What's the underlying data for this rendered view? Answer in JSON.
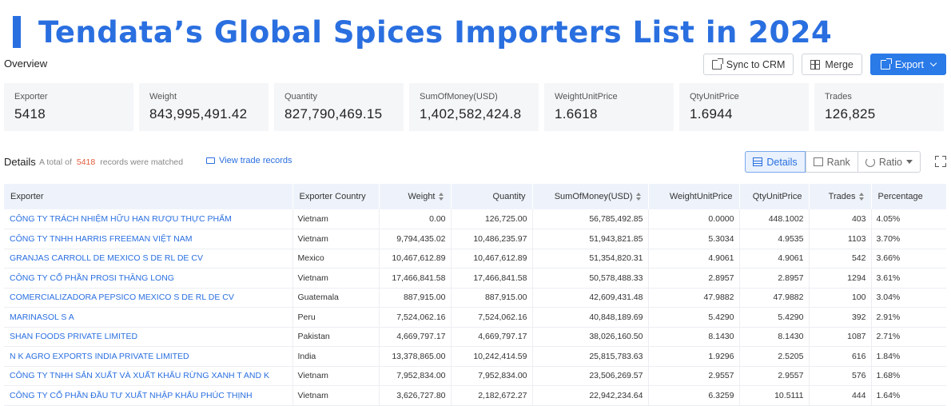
{
  "title": "Tendata’s Global Spices Importers List in 2024",
  "overview_label": "Overview",
  "toolbar": {
    "sync_label": "Sync to CRM",
    "merge_label": "Merge",
    "export_label": "Export"
  },
  "stats": [
    {
      "label": "Exporter",
      "value": "5418"
    },
    {
      "label": "Weight",
      "value": "843,995,491.42"
    },
    {
      "label": "Quantity",
      "value": "827,790,469.15"
    },
    {
      "label": "SumOfMoney(USD)",
      "value": "1,402,582,424.8"
    },
    {
      "label": "WeightUnitPrice",
      "value": "1.6618"
    },
    {
      "label": "QtyUnitPrice",
      "value": "1.6944"
    },
    {
      "label": "Trades",
      "value": "126,825"
    }
  ],
  "details": {
    "label": "Details",
    "total_prefix": "A total of",
    "count": "5418",
    "total_suffix": "records were matched",
    "view_link": "View trade records",
    "seg_details": "Details",
    "seg_rank": "Rank",
    "seg_ratio": "Ratio"
  },
  "table": {
    "headers": [
      "Exporter",
      "Exporter Country",
      "Weight",
      "Quantity",
      "SumOfMoney(USD)",
      "WeightUnitPrice",
      "QtyUnitPrice",
      "Trades",
      "Percentage"
    ],
    "rows": [
      [
        "CÔNG TY TRÁCH NHIỆM HỮU HẠN RƯỢU THỰC PHẨM",
        "Vietnam",
        "0.00",
        "126,725.00",
        "56,785,492.85",
        "0.0000",
        "448.1002",
        "403",
        "4.05%"
      ],
      [
        "CÔNG TY TNHH HARRIS FREEMAN VIỆT NAM",
        "Vietnam",
        "9,794,435.02",
        "10,486,235.97",
        "51,943,821.85",
        "5.3034",
        "4.9535",
        "1103",
        "3.70%"
      ],
      [
        "GRANJAS CARROLL DE MEXICO S DE RL DE CV",
        "Mexico",
        "10,467,612.89",
        "10,467,612.89",
        "51,354,820.31",
        "4.9061",
        "4.9061",
        "542",
        "3.66%"
      ],
      [
        "CÔNG TY CỔ PHẦN PROSI THĂNG LONG",
        "Vietnam",
        "17,466,841.58",
        "17,466,841.58",
        "50,578,488.33",
        "2.8957",
        "2.8957",
        "1294",
        "3.61%"
      ],
      [
        "COMERCIALIZADORA PEPSICO MEXICO S DE RL DE CV",
        "Guatemala",
        "887,915.00",
        "887,915.00",
        "42,609,431.48",
        "47.9882",
        "47.9882",
        "100",
        "3.04%"
      ],
      [
        "MARINASOL S A",
        "Peru",
        "7,524,062.16",
        "7,524,062.16",
        "40,848,189.69",
        "5.4290",
        "5.4290",
        "392",
        "2.91%"
      ],
      [
        "SHAN FOODS PRIVATE LIMITED",
        "Pakistan",
        "4,669,797.17",
        "4,669,797.17",
        "38,026,160.50",
        "8.1430",
        "8.1430",
        "1087",
        "2.71%"
      ],
      [
        "N K AGRO EXPORTS INDIA PRIVATE LIMITED",
        "India",
        "13,378,865.00",
        "10,242,414.59",
        "25,815,783.63",
        "1.9296",
        "2.5205",
        "616",
        "1.84%"
      ],
      [
        "CÔNG TY TNHH SẢN XUẤT VÀ XUẤT KHẨU RỪNG XANH T AND K",
        "Vietnam",
        "7,952,834.00",
        "7,952,834.00",
        "23,506,269.57",
        "2.9557",
        "2.9557",
        "576",
        "1.68%"
      ],
      [
        "CÔNG TY CỔ PHẦN ĐẦU TƯ XUẤT NHẬP KHẨU PHÚC THỊNH",
        "Vietnam",
        "3,626,727.80",
        "2,182,672.27",
        "22,942,234.64",
        "6.3259",
        "10.5111",
        "444",
        "1.64%"
      ]
    ]
  },
  "colors": {
    "accent": "#2a6fe0",
    "primary_button": "#2a7ae8",
    "count_highlight": "#e25a3a",
    "header_bg": "#eef3fb"
  }
}
